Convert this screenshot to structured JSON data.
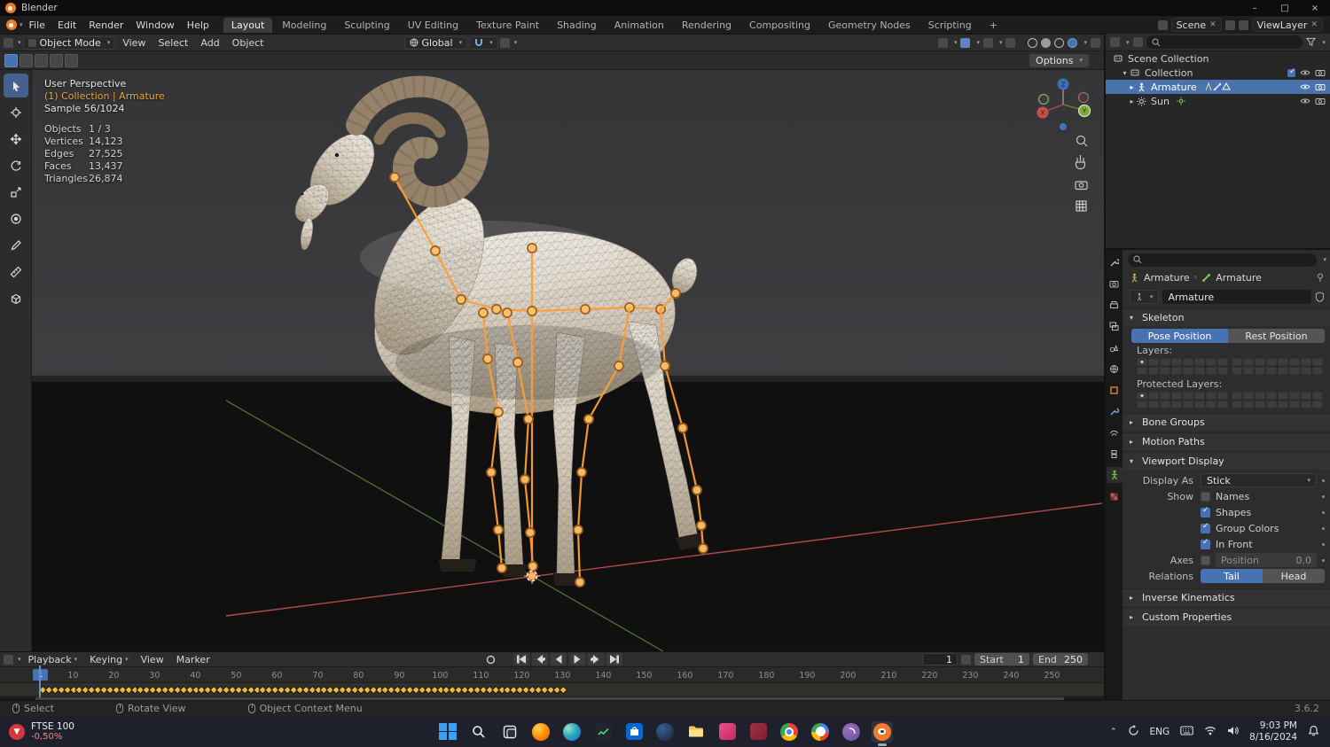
{
  "window": {
    "title": "Blender",
    "minimize": "–",
    "maximize": "□",
    "close": "×"
  },
  "topbar": {
    "menus": [
      "File",
      "Edit",
      "Render",
      "Window",
      "Help"
    ],
    "workspaces": [
      "Layout",
      "Modeling",
      "Sculpting",
      "UV Editing",
      "Texture Paint",
      "Shading",
      "Animation",
      "Rendering",
      "Compositing",
      "Geometry Nodes",
      "Scripting"
    ],
    "add_workspace": "+",
    "scene_label": "Scene",
    "viewlayer_label": "ViewLayer"
  },
  "viewport_header": {
    "mode": "Object Mode",
    "menus": [
      "View",
      "Select",
      "Add",
      "Object"
    ],
    "orientation": "Global",
    "options_label": "Options"
  },
  "viewport": {
    "perspective": "User Perspective",
    "context": "(1) Collection | Armature",
    "sample": "Sample 56/1024",
    "stats": [
      {
        "label": "Objects",
        "value": "1 / 3"
      },
      {
        "label": "Vertices",
        "value": "14,123"
      },
      {
        "label": "Edges",
        "value": "27,525"
      },
      {
        "label": "Faces",
        "value": "13,437"
      },
      {
        "label": "Triangles",
        "value": "26,874"
      }
    ],
    "gizmo": {
      "x": "X",
      "y": "Y",
      "z": "Z"
    }
  },
  "outliner": {
    "rows": [
      {
        "label": "Scene Collection"
      },
      {
        "label": "Collection"
      },
      {
        "label": "Armature"
      },
      {
        "label": "Sun"
      }
    ]
  },
  "properties": {
    "breadcrumb": {
      "object": "Armature",
      "data": "Armature"
    },
    "name_value": "Armature",
    "skeleton": {
      "title": "Skeleton",
      "pose": "Pose Position",
      "rest": "Rest Position",
      "layers_label": "Layers:",
      "protected_label": "Protected Layers:"
    },
    "bone_groups_title": "Bone Groups",
    "motion_paths_title": "Motion Paths",
    "viewport_display": {
      "title": "Viewport Display",
      "display_as_label": "Display As",
      "display_as_value": "Stick",
      "show_label": "Show",
      "toggles": [
        {
          "label": "Names",
          "checked": false
        },
        {
          "label": "Shapes",
          "checked": true
        },
        {
          "label": "Group Colors",
          "checked": true
        },
        {
          "label": "In Front",
          "checked": true
        }
      ],
      "axes_label": "Axes",
      "position_label": "Position",
      "position_value": "0.0",
      "relations_label": "Relations",
      "tail": "Tail",
      "head": "Head"
    },
    "inverse_kinematics_title": "Inverse Kinematics",
    "custom_properties_title": "Custom Properties"
  },
  "timeline": {
    "menus": [
      "Playback",
      "Keying",
      "View",
      "Marker"
    ],
    "current_frame": "1",
    "start_label": "Start",
    "start_value": "1",
    "end_label": "End",
    "end_value": "250",
    "tick_labels": [
      10,
      20,
      30,
      40,
      50,
      60,
      70,
      80,
      90,
      100,
      110,
      120,
      130,
      140,
      150,
      160,
      170,
      180,
      190,
      200,
      210,
      220,
      230,
      240,
      250
    ],
    "keyframes": {
      "count": 86,
      "first_frame": 1
    }
  },
  "statusbar": {
    "items": [
      "Select",
      "Rotate View",
      "Object Context Menu"
    ],
    "version": "3.6.2"
  },
  "taskbar": {
    "widget": {
      "title": "FTSE 100",
      "change": "-0,50%"
    },
    "pinned": [
      "start",
      "search",
      "task-view",
      "firefox",
      "edge",
      "stocks",
      "store",
      "steam",
      "file-explorer",
      "mail",
      "database",
      "chrome",
      "google",
      "viber",
      "blender"
    ],
    "tray": {
      "language": "ENG",
      "time": "9:03 PM",
      "date": "8/16/2024"
    }
  }
}
